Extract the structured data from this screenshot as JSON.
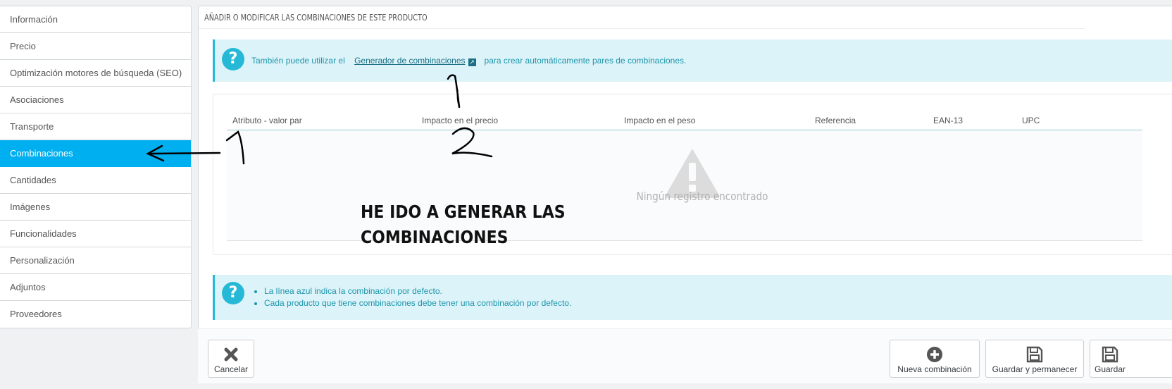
{
  "sidebar": {
    "items": [
      {
        "label": "Información"
      },
      {
        "label": "Precio"
      },
      {
        "label": "Optimización motores de búsqueda (SEO)"
      },
      {
        "label": "Asociaciones"
      },
      {
        "label": "Transporte"
      },
      {
        "label": "Combinaciones",
        "active": true
      },
      {
        "label": "Cantidades"
      },
      {
        "label": "Imágenes"
      },
      {
        "label": "Funcionalidades"
      },
      {
        "label": "Personalización"
      },
      {
        "label": "Adjuntos"
      },
      {
        "label": "Proveedores"
      }
    ]
  },
  "panel": {
    "title": "AÑADIR O MODIFICAR LAS COMBINACIONES DE ESTE PRODUCTO"
  },
  "info_top": {
    "prefix": "También puede utilizar el",
    "link": "Generador de combinaciones",
    "suffix": "para crear automáticamente pares de combinaciones."
  },
  "table": {
    "headers": [
      "Atributo - valor par",
      "Impacto en el precio",
      "Impacto en el peso",
      "Referencia",
      "EAN-13",
      "UPC"
    ],
    "empty_text": "Ningún registro encontrado"
  },
  "info_bottom": {
    "bullets": [
      "La línea azul indica la combinación por defecto.",
      "Cada producto que tiene combinaciones debe tener una combinación por defecto."
    ]
  },
  "annotation": {
    "line1": "HE IDO A GENERAR LAS",
    "line2": "COMBINACIONES"
  },
  "footer": {
    "cancel": "Cancelar",
    "new_combination": "Nueva combinación",
    "save_stay": "Guardar y permanecer",
    "save": "Guardar"
  },
  "colors": {
    "accent": "#00aff0",
    "info_bg": "#dcf4f9",
    "info_border": "#25b9d7"
  }
}
